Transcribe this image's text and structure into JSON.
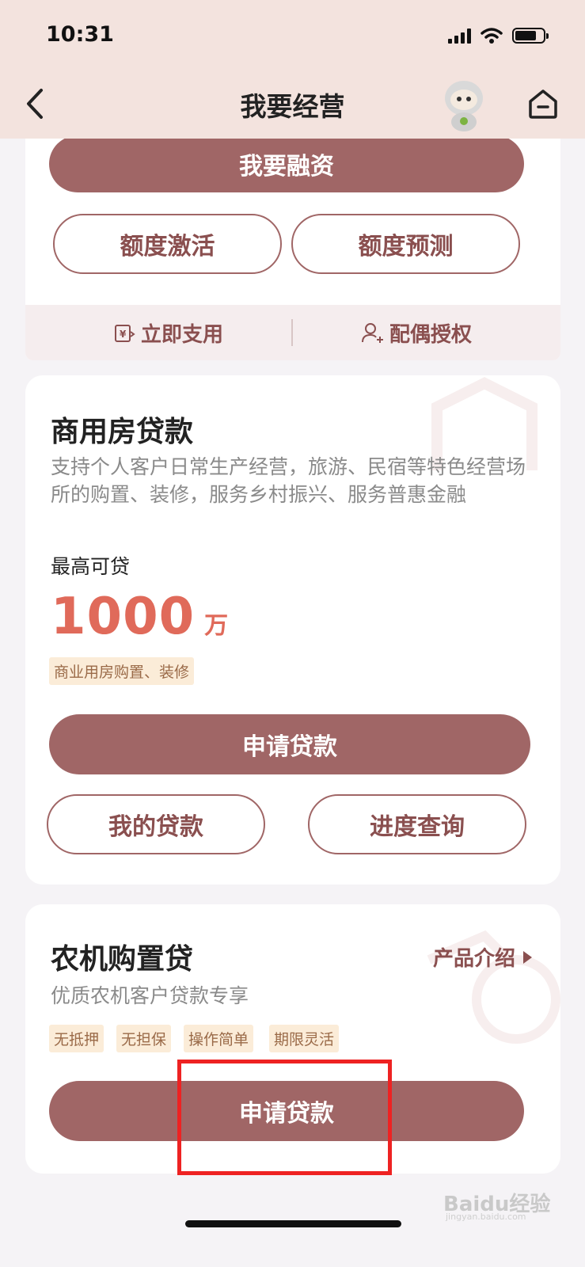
{
  "status_bar": {
    "time": "10:31"
  },
  "header": {
    "title": "我要经营"
  },
  "top_card": {
    "finance_button": "我要融资",
    "activate_button": "额度激活",
    "predict_button": "额度预测",
    "quick_use_label": "立即支用",
    "spouse_auth_label": "配偶授权"
  },
  "commercial_loan": {
    "title": "商用房贷款",
    "description": "支持个人客户日常生产经营，旅游、民宿等特色经营场所的购置、装修，服务乡村振兴、服务普惠金融",
    "max_label": "最高可贷",
    "amount": "1000",
    "unit": "万",
    "tag": "商业用房购置、装修",
    "apply_button": "申请贷款",
    "my_loans_button": "我的贷款",
    "progress_button": "进度查询"
  },
  "farm_loan": {
    "title": "农机购置贷",
    "intro_link": "产品介绍",
    "description": "优质农机客户贷款专享",
    "tags": [
      "无抵押",
      "无担保",
      "操作简单",
      "期限灵活"
    ],
    "apply_button": "申请贷款"
  },
  "watermark": {
    "text": "Baidu经验",
    "sub": "jingyan.baidu.com"
  },
  "colors": {
    "primary": "#a06666",
    "accent": "#e06a5a",
    "header_bg": "#f3e3de",
    "highlight": "#ee2222"
  }
}
